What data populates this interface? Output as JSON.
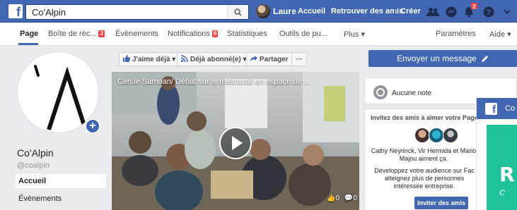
{
  "search": {
    "value": "Co'Alpin"
  },
  "topbar": {
    "user_name": "Laure",
    "home": "Accueil",
    "find_friends": "Retrouver des amis",
    "create": "Créer",
    "notif_count": "2"
  },
  "pagenav": {
    "items": [
      {
        "label": "Page"
      },
      {
        "label": "Boîte de réc...",
        "badge": "3"
      },
      {
        "label": "Évènements"
      },
      {
        "label": "Notifications",
        "badge": "6"
      },
      {
        "label": "Statistiques"
      },
      {
        "label": "Outils de pu..."
      },
      {
        "label": "Plus ▾"
      },
      {
        "label": "Paramètres"
      },
      {
        "label": "Aide ▾"
      }
    ]
  },
  "profile": {
    "name": "Co'Alpin",
    "handle": "@coalpin"
  },
  "sidebar": {
    "items": [
      {
        "label": "Accueil"
      },
      {
        "label": "Évènements"
      }
    ]
  },
  "actions": {
    "like": "J'aime déjà ▾",
    "follow": "Déjà abonné(e) ▾",
    "share": "Partager",
    "more": "···",
    "send_message": "Envoyer un message"
  },
  "video": {
    "title": "Cercle Samoan/ Débat sur le télétravail en espace de ...",
    "likes": "0",
    "comments": "0"
  },
  "rating": {
    "label": "Aucune note"
  },
  "invite": {
    "title": "Invitez des amis à aimer votre Page",
    "likes_text": "Cathy Neyrinck, Vir Hermida et Mario Majou aiment ça.",
    "grow_text": "Développez votre audience sur Fac atteignez plus de personnes intéressée entreprise.",
    "button": "Inviter des amis"
  },
  "popup": {
    "title": "Co"
  },
  "colors": {
    "facebook_blue": "#4267b2",
    "badge_red": "#fa3e3e",
    "popup_green": "#1ec39b"
  }
}
